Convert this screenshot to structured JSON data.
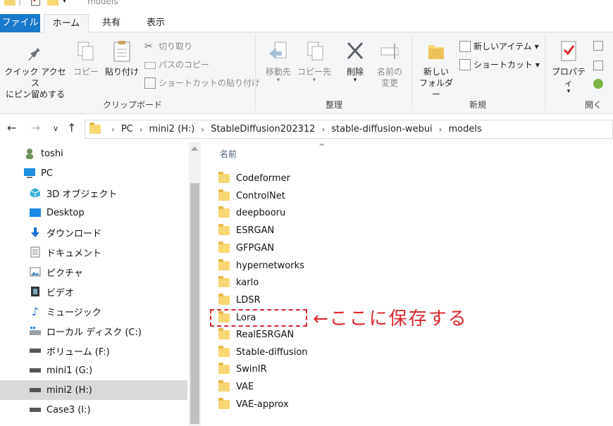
{
  "window": {
    "title": "models"
  },
  "ribbon": {
    "tabs": [
      {
        "label": "ファイル",
        "active": false
      },
      {
        "label": "ホーム",
        "active": true
      },
      {
        "label": "共有",
        "active": false
      },
      {
        "label": "表示",
        "active": false
      }
    ],
    "clipboard": {
      "group_label": "クリップボード",
      "pin_line1": "クイック アクセス",
      "pin_line2": "にピン留めする",
      "copy": "コピー",
      "paste": "貼り付け",
      "cut": "切り取り",
      "copy_path": "パスのコピー",
      "paste_shortcut": "ショートカットの貼り付け"
    },
    "organize": {
      "group_label": "整理",
      "move_to": "移動先",
      "copy_to": "コピー先",
      "delete": "削除",
      "rename_line1": "名前の",
      "rename_line2": "変更"
    },
    "new": {
      "group_label": "新規",
      "new_folder_line1": "新しい",
      "new_folder_line2": "フォルダー",
      "new_item": "新しいアイテム ▾",
      "shortcut": "ショートカット ▾"
    },
    "open": {
      "group_label": "開く",
      "properties": "プロパティ"
    }
  },
  "address": {
    "crumbs": [
      "PC",
      "mini2 (H:)",
      "StableDiffusion202312",
      "stable-diffusion-webui",
      "models"
    ]
  },
  "navpane": {
    "items": [
      {
        "label": "toshi",
        "icon": "user-icon",
        "selected": false
      },
      {
        "label": "PC",
        "icon": "computer-icon",
        "selected": false
      },
      {
        "label": "3D オブジェクト",
        "icon": "cube-icon",
        "selected": false
      },
      {
        "label": "Desktop",
        "icon": "desktop-icon",
        "selected": false
      },
      {
        "label": "ダウンロード",
        "icon": "download-icon",
        "selected": false
      },
      {
        "label": "ドキュメント",
        "icon": "document-icon",
        "selected": false
      },
      {
        "label": "ピクチャ",
        "icon": "picture-icon",
        "selected": false
      },
      {
        "label": "ビデオ",
        "icon": "video-icon",
        "selected": false
      },
      {
        "label": "ミュージック",
        "icon": "music-icon",
        "selected": false
      },
      {
        "label": "ローカル ディスク (C:)",
        "icon": "windows-drive-icon",
        "selected": false
      },
      {
        "label": "ボリューム (F:)",
        "icon": "drive-icon",
        "selected": false
      },
      {
        "label": "mini1 (G:)",
        "icon": "drive-icon",
        "selected": false
      },
      {
        "label": "mini2 (H:)",
        "icon": "drive-icon",
        "selected": true
      },
      {
        "label": "Case3 (I:)",
        "icon": "drive-icon",
        "selected": false
      }
    ]
  },
  "filelist": {
    "column_name": "名前",
    "sort_indicator": "^",
    "folders": [
      "Codeformer",
      "ControlNet",
      "deepbooru",
      "ESRGAN",
      "GFPGAN",
      "hypernetworks",
      "karlo",
      "LDSR",
      "Lora",
      "RealESRGAN",
      "Stable-diffusion",
      "SwinIR",
      "VAE",
      "VAE-approx"
    ]
  },
  "annotation": {
    "text": "←ここに保存する",
    "color": "#d9272b"
  },
  "colors": {
    "file_tab": "#1979ca",
    "folder": "#f8d775",
    "selected_nav": "#d9d9d9"
  }
}
